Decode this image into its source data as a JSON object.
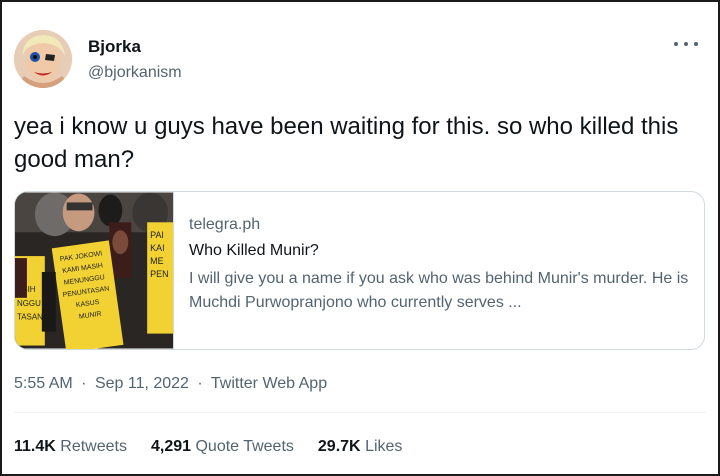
{
  "author": {
    "display_name": "Bjorka",
    "handle": "@bjorkanism"
  },
  "tweet": {
    "text": "yea i know u guys have been waiting for this. so who killed this good man?"
  },
  "card": {
    "domain": "telegra.ph",
    "title": "Who Killed Munir?",
    "description": "I will give you a name if you ask who was behind Munir's murder. He is Muchdi Purwopranjono who currently serves ...",
    "image_signs": [
      "PAK JOKOWI KAMI MASIH MENUNGGU PENUNTASAN KASUS MUNIR",
      "PAI KAI ME PEN",
      "WI ASIH NGGU TASAN"
    ]
  },
  "meta": {
    "time": "5:55 AM",
    "sep": "·",
    "date": "Sep 11, 2022",
    "source": "Twitter Web App"
  },
  "stats": {
    "retweets_count": "11.4K",
    "retweets_label": "Retweets",
    "quotes_count": "4,291",
    "quotes_label": "Quote Tweets",
    "likes_count": "29.7K",
    "likes_label": "Likes"
  },
  "colors": {
    "text": "#0f1419",
    "secondary": "#536471",
    "border": "#cfd9de",
    "sign_yellow": "#f2d233"
  },
  "icons": [
    "more-options-icon"
  ]
}
